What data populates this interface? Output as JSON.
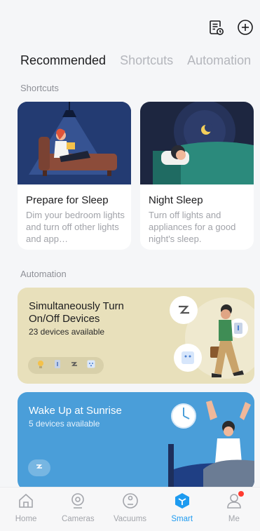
{
  "tabs": [
    {
      "label": "Recommended",
      "active": true
    },
    {
      "label": "Shortcuts",
      "active": false
    },
    {
      "label": "Automation",
      "active": false
    }
  ],
  "sections": {
    "shortcuts_label": "Shortcuts",
    "automation_label": "Automation"
  },
  "shortcuts": [
    {
      "title": "Prepare for Sleep",
      "description": "Dim your bedroom lights and turn off other lights and app…"
    },
    {
      "title": "Night Sleep",
      "description": "Turn off lights and appliances for a good night's sleep."
    }
  ],
  "automations": [
    {
      "title": "Simultaneously Turn On/Off Devices",
      "subtitle": "23 devices available",
      "bg": "#e8e0bb"
    },
    {
      "title": "Wake Up at Sunrise",
      "subtitle": "5 devices available",
      "bg": "#4a9ed9"
    }
  ],
  "nav": [
    {
      "label": "Home",
      "icon": "home-icon",
      "active": false
    },
    {
      "label": "Cameras",
      "icon": "camera-icon",
      "active": false
    },
    {
      "label": "Vacuums",
      "icon": "vacuum-icon",
      "active": false
    },
    {
      "label": "Smart",
      "icon": "cube-icon",
      "active": true
    },
    {
      "label": "Me",
      "icon": "user-icon",
      "active": false
    }
  ],
  "colors": {
    "accent": "#1e9bf0",
    "badge": "#ff3b30"
  }
}
